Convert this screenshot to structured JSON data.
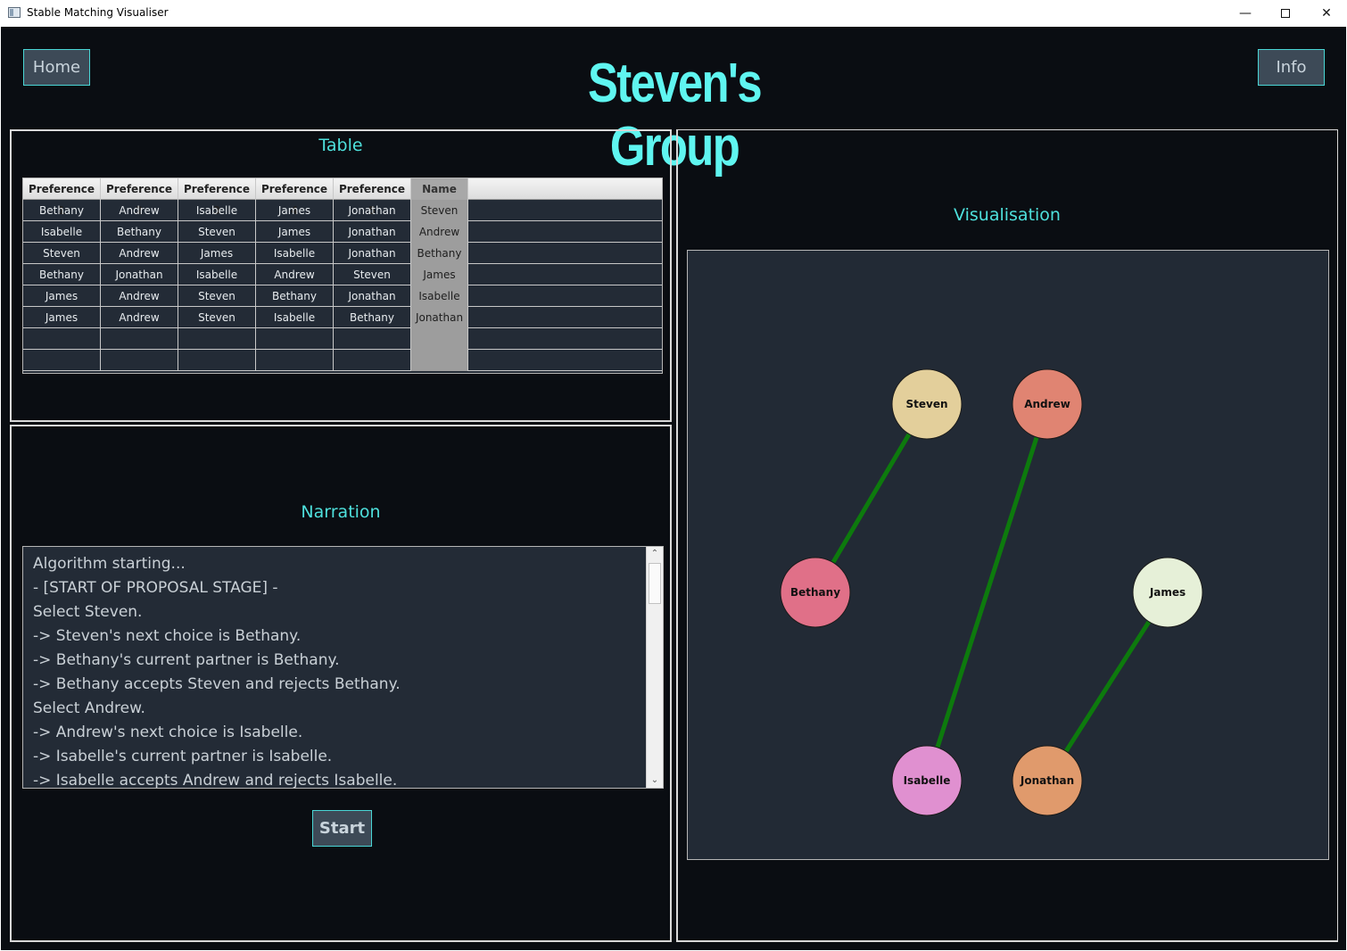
{
  "window": {
    "title": "Stable Matching Visualiser",
    "icons": [
      "app-window-icon",
      "minimize-icon",
      "maximize-icon",
      "close-icon"
    ]
  },
  "header": {
    "home_label": "Home",
    "info_label": "Info",
    "group_title": "Steven's Group"
  },
  "table_panel": {
    "title": "Table",
    "columns": [
      "Preference 1",
      "Preference 2",
      "Preference 3",
      "Preference 4",
      "Preference 5",
      "Name"
    ],
    "rows": [
      [
        "Bethany",
        "Andrew",
        "Isabelle",
        "James",
        "Jonathan",
        "Steven"
      ],
      [
        "Isabelle",
        "Bethany",
        "Steven",
        "James",
        "Jonathan",
        "Andrew"
      ],
      [
        "Steven",
        "Andrew",
        "James",
        "Isabelle",
        "Jonathan",
        "Bethany"
      ],
      [
        "Bethany",
        "Jonathan",
        "Isabelle",
        "Andrew",
        "Steven",
        "James"
      ],
      [
        "James",
        "Andrew",
        "Steven",
        "Bethany",
        "Jonathan",
        "Isabelle"
      ],
      [
        "James",
        "Andrew",
        "Steven",
        "Isabelle",
        "Bethany",
        "Jonathan"
      ]
    ]
  },
  "narration_panel": {
    "title": "Narration",
    "lines": [
      "Algorithm starting...",
      "- [START OF PROPOSAL STAGE] -",
      "Select Steven.",
      "-> Steven's next choice is Bethany.",
      "-> Bethany's current partner is Bethany.",
      "-> Bethany accepts Steven and rejects Bethany.",
      "Select Andrew.",
      "-> Andrew's next choice is Isabelle.",
      "-> Isabelle's current partner is Isabelle.",
      "-> Isabelle accepts Andrew and rejects Isabelle."
    ],
    "start_label": "Start"
  },
  "visualisation_panel": {
    "title": "Visualisation",
    "edge_color": "#0d7a0d",
    "nodes": [
      {
        "name": "Steven",
        "color": "#e3cf9b"
      },
      {
        "name": "Andrew",
        "color": "#e08472"
      },
      {
        "name": "Bethany",
        "color": "#e07088"
      },
      {
        "name": "James",
        "color": "#e6f0d8"
      },
      {
        "name": "Isabelle",
        "color": "#e090d0"
      },
      {
        "name": "Jonathan",
        "color": "#e09a6c"
      }
    ],
    "edges": [
      [
        "Steven",
        "Bethany"
      ],
      [
        "Andrew",
        "Isabelle"
      ],
      [
        "James",
        "Jonathan"
      ]
    ]
  },
  "colors": {
    "background": "#0a0d12",
    "accent": "#4ee0dc",
    "title": "#5ff5f0",
    "panel_fill": "#232b36"
  }
}
